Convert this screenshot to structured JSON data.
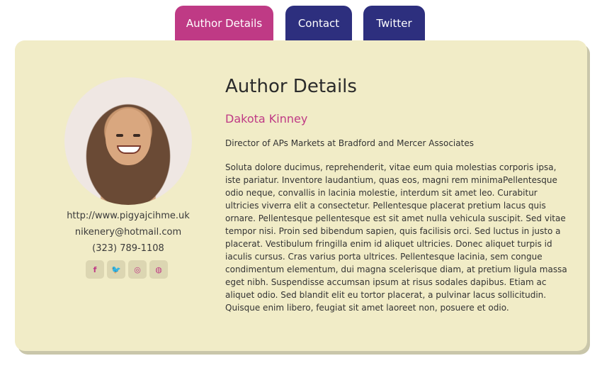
{
  "tabs": [
    {
      "label": "Author Details"
    },
    {
      "label": "Contact"
    },
    {
      "label": "Twitter"
    }
  ],
  "author": {
    "heading": "Author Details",
    "name": "Dakota Kinney",
    "role": "Director of APs Markets at Bradford and Mercer Associates",
    "bio": "Soluta dolore ducimus, reprehenderit, vitae eum quia molestias corporis ipsa, iste pariatur. Inventore laudantium, quas eos, magni rem minimaPellentesque odio neque, convallis in lacinia molestie, interdum sit amet leo. Curabitur ultricies viverra elit a consectetur. Pellentesque placerat pretium lacus quis ornare. Pellentesque pellentesque est sit amet nulla vehicula suscipit. Sed vitae tempor nisi. Proin sed bibendum sapien, quis facilisis orci. Sed luctus in justo a placerat. Vestibulum fringilla enim id aliquet ultricies. Donec aliquet turpis id iaculis cursus. Cras varius porta ultrices. Pellentesque lacinia, sem congue condimentum elementum, dui magna scelerisque diam, at pretium ligula massa eget nibh. Suspendisse accumsan ipsum at risus sodales dapibus. Etiam ac aliquet odio. Sed blandit elit eu tortor placerat, a pulvinar lacus sollicitudin. Quisque enim libero, feugiat sit amet laoreet non, posuere et odio."
  },
  "contact": {
    "website": "http://www.pigyajcihme.uk",
    "email": "nikenery@hotmail.com",
    "phone": "(323) 789-1108"
  },
  "social": [
    {
      "icon": "facebook-icon",
      "glyph": "f"
    },
    {
      "icon": "twitter-icon",
      "glyph": "🐦"
    },
    {
      "icon": "instagram-icon",
      "glyph": "◎"
    },
    {
      "icon": "dribbble-icon",
      "glyph": "◍"
    }
  ],
  "colors": {
    "accent": "#bf3a85",
    "tab_dark": "#2d2f7e",
    "card_bg": "#f1ecc7"
  }
}
